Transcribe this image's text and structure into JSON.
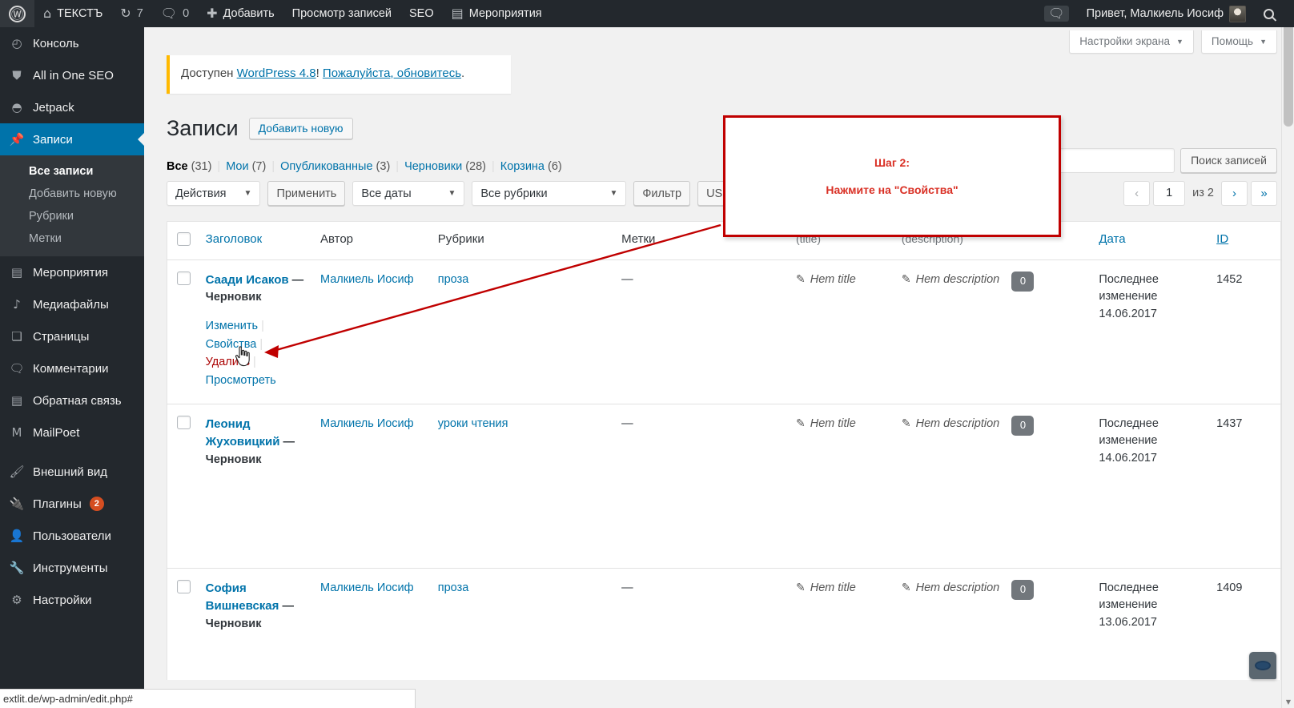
{
  "adminbar": {
    "logo_icon": "wordpress-logo-icon",
    "items": [
      {
        "icon": "home-icon",
        "label": "ТЕКСТЪ",
        "name": "site-name"
      },
      {
        "icon": "updates-icon",
        "label": "7",
        "name": "updates"
      },
      {
        "icon": "comment-icon",
        "label": "0",
        "name": "comments"
      },
      {
        "icon": "plus-icon",
        "label": "Добавить",
        "name": "new-content"
      },
      {
        "icon": "",
        "label": "Просмотр записей",
        "name": "view-posts"
      },
      {
        "icon": "",
        "label": "SEO",
        "name": "seo"
      },
      {
        "icon": "calendar-icon",
        "label": "Мероприятия",
        "name": "events"
      }
    ],
    "greeting": "Привет, Малкиель Иосиф",
    "notification_icon": "comment-icon",
    "avatar": "user-avatar",
    "search_icon": "search-icon"
  },
  "sidebar": {
    "items": [
      {
        "icon": "dashboard-icon",
        "label": "Консоль",
        "name": "dashboard"
      },
      {
        "icon": "shield-icon",
        "label": "All in One SEO",
        "name": "all-in-one-seo"
      },
      {
        "icon": "jetpack-icon",
        "label": "Jetpack",
        "name": "jetpack"
      },
      {
        "icon": "pin-icon",
        "label": "Записи",
        "name": "posts",
        "current": true
      },
      {
        "icon": "calendar-icon",
        "label": "Мероприятия",
        "name": "events"
      },
      {
        "icon": "media-icon",
        "label": "Медиафайлы",
        "name": "media"
      },
      {
        "icon": "pages-icon",
        "label": "Страницы",
        "name": "pages"
      },
      {
        "icon": "comment-icon",
        "label": "Комментарии",
        "name": "comments"
      },
      {
        "icon": "feedback-icon",
        "label": "Обратная связь",
        "name": "feedback"
      },
      {
        "icon": "mailpoet-icon",
        "label": "MailPoet",
        "name": "mailpoet"
      },
      {
        "icon": "appearance-icon",
        "label": "Внешний вид",
        "name": "appearance"
      },
      {
        "icon": "plugins-icon",
        "label": "Плагины",
        "name": "plugins",
        "badge": "2"
      },
      {
        "icon": "users-icon",
        "label": "Пользователи",
        "name": "users"
      },
      {
        "icon": "tools-icon",
        "label": "Инструменты",
        "name": "tools"
      },
      {
        "icon": "settings-icon",
        "label": "Настройки",
        "name": "settings"
      }
    ],
    "submenu": [
      {
        "label": "Все записи",
        "active": true
      },
      {
        "label": "Добавить новую",
        "active": false
      },
      {
        "label": "Рубрики",
        "active": false
      },
      {
        "label": "Метки",
        "active": false
      }
    ]
  },
  "screen_meta": {
    "screen_options": "Настройки экрана",
    "help": "Помощь",
    "caret": "▼"
  },
  "notice": {
    "prefix": "Доступен ",
    "link1": "WordPress 4.8",
    "middle": "! ",
    "link2": "Пожалуйста, обновитесь",
    "suffix": "."
  },
  "page": {
    "title": "Записи",
    "add_new": "Добавить новую"
  },
  "filters": {
    "views": [
      {
        "label": "Все",
        "count": "(31)",
        "current": true
      },
      {
        "label": "Мои",
        "count": "(7)",
        "current": false
      },
      {
        "label": "Опубликованные",
        "count": "(3)",
        "current": false
      },
      {
        "label": "Черновики",
        "count": "(28)",
        "current": false
      },
      {
        "label": "Корзина",
        "count": "(6)",
        "current": false
      }
    ],
    "separator": "|",
    "bulk_actions": "Действия",
    "apply": "Применить",
    "all_dates": "Все даты",
    "all_categories": "Все рубрики",
    "filter": "Фильтр",
    "partial_button": "US",
    "caret": "▼"
  },
  "search": {
    "value": "",
    "placeholder": "",
    "submit": "Поиск записей"
  },
  "pagination": {
    "first": "«",
    "prev": "‹",
    "current": "1",
    "of_label": "из 2",
    "next": "›",
    "last": "»"
  },
  "table": {
    "columns": [
      {
        "key": "cb",
        "label": "",
        "sortable": false
      },
      {
        "key": "title",
        "label": "Заголовок",
        "sortable": true
      },
      {
        "key": "author",
        "label": "Автор",
        "sortable": false
      },
      {
        "key": "categories",
        "label": "Рубрики",
        "sortable": false
      },
      {
        "key": "tags",
        "label": "Метки",
        "sortable": false
      },
      {
        "key": "seo_title",
        "label": "",
        "sub": "(title)",
        "sortable": false
      },
      {
        "key": "seo_desc",
        "label": "",
        "sub": "(description)",
        "sortable": false
      },
      {
        "key": "comments",
        "label": "",
        "sortable": false
      },
      {
        "key": "date",
        "label": "Дата",
        "sortable": true
      },
      {
        "key": "id",
        "label": "ID",
        "sortable": true
      }
    ],
    "rows": [
      {
        "title": "Саади Исаков",
        "title_sep": " — ",
        "status": "Черновик",
        "author": "Малкиель Иосиф",
        "categories": "проза",
        "tags": "—",
        "seo_title": "Нет title",
        "seo_desc": "Нет description",
        "comments": "0",
        "date_label": "Последнее изменение",
        "date_value": "14.06.2017",
        "id": "1452",
        "actions": [
          {
            "label": "Изменить",
            "type": "edit"
          },
          {
            "label": "Свойства",
            "type": "properties"
          },
          {
            "label": "Удалить",
            "type": "trash"
          },
          {
            "label": "Просмотреть",
            "type": "view"
          }
        ],
        "actions_visible": true
      },
      {
        "title": "Леонид Жуховицкий",
        "title_sep": " — ",
        "status": "Черновик",
        "author": "Малкиель Иосиф",
        "categories": "уроки чтения",
        "tags": "—",
        "seo_title": "Нет title",
        "seo_desc": "Нет description",
        "comments": "0",
        "date_label": "Последнее изменение",
        "date_value": "14.06.2017",
        "id": "1437",
        "actions": [],
        "actions_visible": false
      },
      {
        "title": "София Вишневская",
        "title_sep": " — ",
        "status": "Черновик",
        "author": "Малкиель Иосиф",
        "categories": "проза",
        "tags": "—",
        "seo_title": "Нет title",
        "seo_desc": "Нет description",
        "comments": "0",
        "date_label": "Последнее изменение",
        "date_value": "13.06.2017",
        "id": "1409",
        "actions": [],
        "actions_visible": false
      }
    ]
  },
  "callout": {
    "line1": "Шаг 2:",
    "line2": "Нажмите на \"Свойства\"",
    "border_color": "#c00000",
    "text_color": "#d93025"
  },
  "statusbar": {
    "url": "extlit.de/wp-admin/edit.php#"
  },
  "colors": {
    "accent": "#0073aa",
    "admin_bg": "#23282d",
    "submenu_bg": "#32373c",
    "notice_accent": "#ffb900",
    "badge": "#d54e21",
    "annotation": "#c00000"
  }
}
